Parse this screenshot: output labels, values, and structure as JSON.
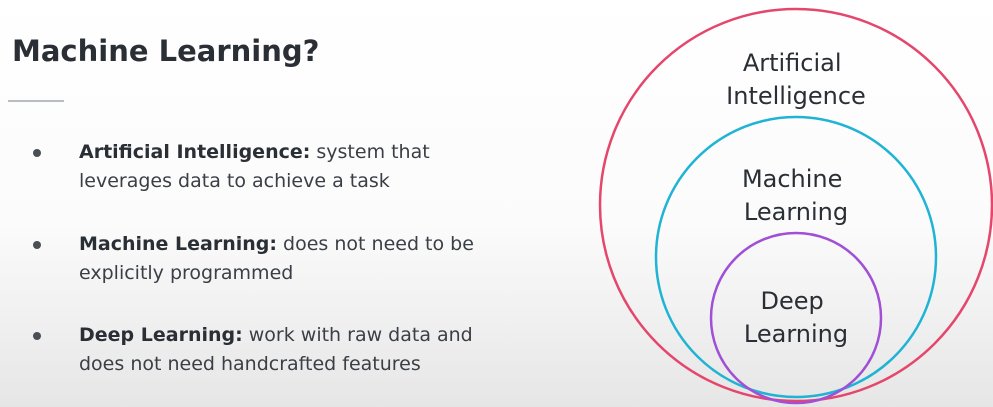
{
  "slide": {
    "title": "Machine Learning?",
    "bullets": [
      {
        "term": "Artificial Intelligence:",
        "line1_rest": " system that",
        "line2": "leverages data to achieve a task"
      },
      {
        "term": "Machine Learning:",
        "line1_rest": " does not need to be",
        "line2": "explicitly programmed"
      },
      {
        "term": "Deep Learning:",
        "line1_rest": " work with raw data and",
        "line2": "does not need handcrafted features"
      }
    ]
  },
  "diagram": {
    "outer": {
      "line1": "Artificial",
      "line2": "Intelligence",
      "color": "#e5466b"
    },
    "middle": {
      "line1": "Machine",
      "line2": "Learning",
      "color": "#1fb3d4"
    },
    "inner": {
      "line1": "Deep",
      "line2": "Learning",
      "color": "#a04fd6"
    }
  }
}
